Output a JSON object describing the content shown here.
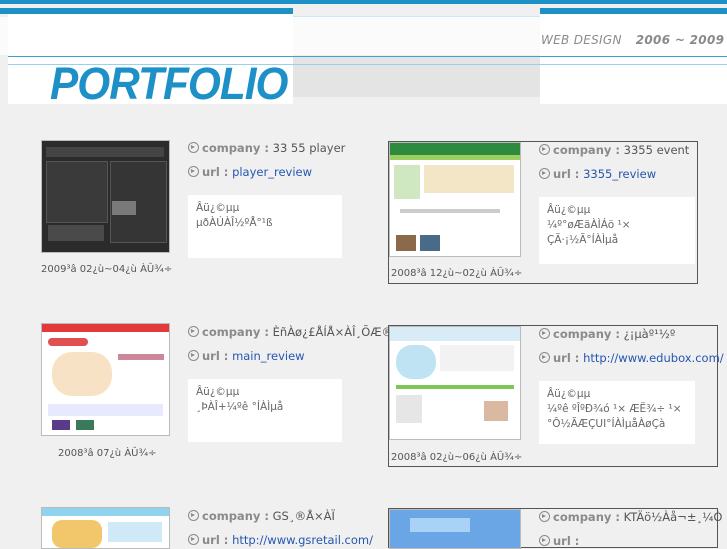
{
  "header": {
    "logo": "PORTFOLIO",
    "caption": "WEB DESIGN",
    "years": "2006 ~ 2009"
  },
  "items": [
    {
      "company_key": "company :",
      "company": "33 55 player",
      "url_key": "url :",
      "url": "player_review",
      "desc": "Âü¿©µµ\nµðÀÚÀÎ½ºÅ°¹ß",
      "date": "2009³â 02¿ù~04¿ù ÀÛ¾÷"
    },
    {
      "company_key": "company :",
      "company": "3355 event",
      "url_key": "url :",
      "url": "3355_review",
      "desc": "Âü¿©µµ\n¼º°øÆäÀÌÁö ¹×\nÇÃ·¡½Ã°ÍÀÌµå",
      "date": "2008³â 12¿ù~02¿ù ÀÛ¾÷"
    },
    {
      "company_key": "company :",
      "company": "ÈñÀø¿£ÅÍÅ×ÀÎ¸ÕÆ®",
      "url_key": "url :",
      "url": "main_review",
      "desc": "Âü¿©µµ\n¸ÞÀÎ+¼­ºê °ÍÀÌµå",
      "date": "2008³â 07¿ù ÀÛ¾÷"
    },
    {
      "company_key": "company :",
      "company": "¿¡µàº¹½º",
      "url_key": "url :",
      "url": "http://www.edubox.com/",
      "desc": "Âü¿©µµ\n¼­ºê ºÎºÐ¾ó ¹× ÆË¾÷ ¹×\n°Ô½ÃÆÇUI°ÍÀÌµåÀøÇà",
      "date": "2008³â 02¿ù~06¿ù ÀÛ¾÷"
    },
    {
      "company_key": "company :",
      "company": "GS¸®Å×ÀÏ",
      "url_key": "url :",
      "url": "http://www.gsretail.com/",
      "desc": "",
      "date": ""
    },
    {
      "company_key": "company :",
      "company": "KTÄö½Àå¬±¸¼Ò",
      "url_key": "url :",
      "url": "",
      "desc": "",
      "date": ""
    }
  ]
}
